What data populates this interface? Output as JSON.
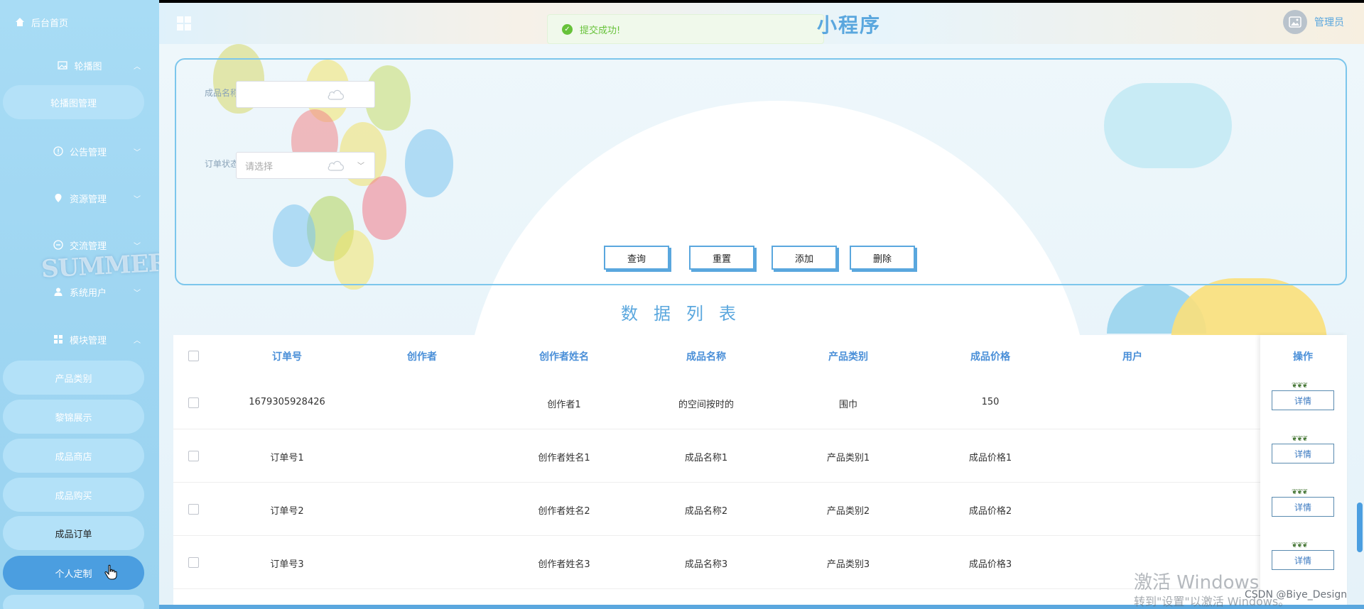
{
  "sidebar": {
    "home": "后台首页",
    "groups": [
      {
        "label": "轮播图",
        "chevron": "up"
      },
      {
        "label": "公告管理",
        "chevron": "down"
      },
      {
        "label": "资源管理",
        "chevron": "down"
      },
      {
        "label": "交流管理",
        "chevron": "down"
      },
      {
        "label": "系统用户",
        "chevron": "down"
      },
      {
        "label": "模块管理",
        "chevron": "up"
      }
    ],
    "carousel_sub": "轮播图管理",
    "module_subs": [
      "产品类别",
      "黎锦展示",
      "成品商店",
      "成品购买",
      "成品订单",
      "个人定制"
    ],
    "decor_text": "SUMMER",
    "icons": [
      "home-icon",
      "image-icon",
      "info-icon",
      "location-icon",
      "chat-icon",
      "user-icon",
      "grid-icon"
    ]
  },
  "header": {
    "title": "小程序",
    "toast": "提交成功!",
    "user": "管理员"
  },
  "search": {
    "name_label": "成品名称",
    "name_value": "",
    "status_label": "订单状态",
    "status_placeholder": "请选择"
  },
  "buttons": {
    "query": "查询",
    "reset": "重置",
    "add": "添加",
    "delete": "删除"
  },
  "list_title": "数据列表",
  "table": {
    "headers": [
      "订单号",
      "创作者",
      "创作者姓名",
      "成品名称",
      "产品类别",
      "成品价格",
      "用户",
      "操作"
    ],
    "detail_label": "详情",
    "rows": [
      [
        "1679305928426",
        "",
        "创作者1",
        "的空间按时的",
        "围巾",
        "150",
        ""
      ],
      [
        "订单号1",
        "",
        "创作者姓名1",
        "成品名称1",
        "产品类别1",
        "成品价格1",
        ""
      ],
      [
        "订单号2",
        "",
        "创作者姓名2",
        "成品名称2",
        "产品类别2",
        "成品价格2",
        ""
      ],
      [
        "订单号3",
        "",
        "创作者姓名3",
        "成品名称3",
        "产品类别3",
        "成品价格3",
        ""
      ]
    ]
  },
  "watermark": {
    "line1": "激活 Windows",
    "line2": "转到\"设置\"以激活 Windows。",
    "csdn": "CSDN @Biye_Design"
  },
  "colors": {
    "accent": "#5aa7de",
    "active": "#4b9ee0",
    "success": "#67c23a"
  }
}
